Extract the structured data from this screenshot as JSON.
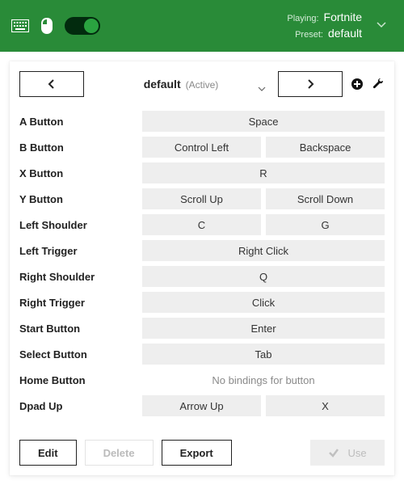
{
  "header": {
    "playing_label": "Playing:",
    "playing_value": "Fortnite",
    "preset_label": "Preset:",
    "preset_value": "default"
  },
  "topbar": {
    "preset_name": "default",
    "preset_status": "(Active)"
  },
  "bindings": [
    {
      "label": "A Button",
      "chips": [
        "Space"
      ]
    },
    {
      "label": "B Button",
      "chips": [
        "Control Left",
        "Backspace"
      ]
    },
    {
      "label": "X Button",
      "chips": [
        "R"
      ]
    },
    {
      "label": "Y Button",
      "chips": [
        "Scroll Up",
        "Scroll Down"
      ]
    },
    {
      "label": "Left Shoulder",
      "chips": [
        "C",
        "G"
      ]
    },
    {
      "label": "Left Trigger",
      "chips": [
        "Right Click"
      ]
    },
    {
      "label": "Right Shoulder",
      "chips": [
        "Q"
      ]
    },
    {
      "label": "Right Trigger",
      "chips": [
        "Click"
      ]
    },
    {
      "label": "Start Button",
      "chips": [
        "Enter"
      ]
    },
    {
      "label": "Select Button",
      "chips": [
        "Tab"
      ]
    },
    {
      "label": "Home Button",
      "empty": "No bindings for button"
    },
    {
      "label": "Dpad Up",
      "chips": [
        "Arrow Up",
        "X"
      ]
    }
  ],
  "footer": {
    "edit": "Edit",
    "delete": "Delete",
    "export": "Export",
    "use": "Use"
  }
}
